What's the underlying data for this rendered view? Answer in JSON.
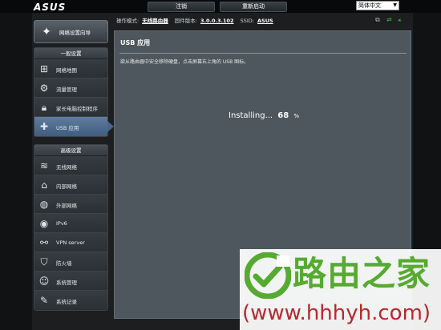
{
  "header": {
    "brand": "ASUS",
    "logout_label": "注销",
    "reboot_label": "重新启动",
    "language": "简体中文"
  },
  "status": {
    "mode_label": "操作模式:",
    "mode_value": "无线路由器",
    "firmware_label": "固件版本:",
    "firmware_value": "3.0.0.3.102",
    "ssid_label": "SSID:",
    "ssid_value": "ASUS",
    "icons": [
      "network-status-icon",
      "internet-status-icon",
      "usb-status-icon"
    ]
  },
  "sidebar": {
    "qis_label": "网络设置向导",
    "general_header": "一般设置",
    "general_items": [
      {
        "label": "网络地图",
        "icon": "network-map-icon"
      },
      {
        "label": "流量管理",
        "icon": "traffic-manager-icon"
      },
      {
        "label": "家长电脑控制程序",
        "icon": "lock-icon"
      },
      {
        "label": "USB 应用",
        "icon": "puzzle-icon",
        "active": true
      }
    ],
    "advanced_header": "高级设置",
    "advanced_items": [
      {
        "label": "无线网络",
        "icon": "wireless-icon"
      },
      {
        "label": "内部网络",
        "icon": "home-icon"
      },
      {
        "label": "外部网络",
        "icon": "globe-icon"
      },
      {
        "label": "IPv6",
        "icon": "ipv6-globe-icon"
      },
      {
        "label": "VPN server",
        "icon": "vpn-icon"
      },
      {
        "label": "防火墙",
        "icon": "shield-icon"
      },
      {
        "label": "系统管理",
        "icon": "admin-user-icon"
      },
      {
        "label": "系统记录",
        "icon": "log-icon"
      }
    ]
  },
  "main": {
    "title": "USB 应用",
    "description": "欲从路由器中安全移除硬盘，点击屏幕右上角的 USB 图标。",
    "installing_text": "Installing...",
    "progress_percent": "68",
    "progress_unit": "%"
  },
  "watermark": {
    "brand": "路由之家",
    "url": "(www.hhhyh.com)"
  },
  "colors": {
    "active_nav": "#4a6688",
    "panel_bg": "#4d575d",
    "watermark_green": "#56aa30",
    "watermark_red": "#b8282c"
  }
}
